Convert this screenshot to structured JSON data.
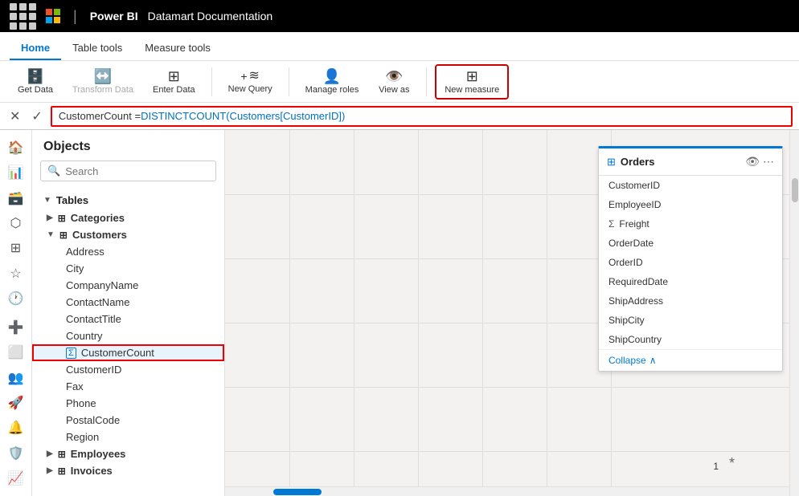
{
  "topbar": {
    "app_name": "Power BI",
    "doc_title": "Datamart Documentation"
  },
  "tabs": {
    "home": "Home",
    "table_tools": "Table tools",
    "measure_tools": "Measure tools"
  },
  "toolbar": {
    "get_data": "Get Data",
    "transform_data": "Transform Data",
    "enter_data": "Enter Data",
    "new_query": "New Query",
    "manage_roles": "Manage roles",
    "view_as": "View as",
    "new_measure": "New measure"
  },
  "formula": {
    "text": "CustomerCount = DISTINCTCOUNT(Customers[CustomerID])"
  },
  "objects_panel": {
    "title": "Objects",
    "search_placeholder": "Search"
  },
  "tree": {
    "tables_label": "Tables",
    "categories": "Categories",
    "customers": "Customers",
    "customers_fields": [
      "Address",
      "City",
      "CompanyName",
      "ContactName",
      "ContactTitle",
      "Country"
    ],
    "customer_count": "CustomerCount",
    "customers_fields2": [
      "CustomerID",
      "Fax",
      "Phone",
      "PostalCode",
      "Region"
    ],
    "employees": "Employees",
    "invoices": "Invoices"
  },
  "orders_card": {
    "title": "Orders",
    "fields": [
      "CustomerID",
      "EmployeeID",
      "Freight",
      "OrderDate",
      "OrderID",
      "RequiredDate",
      "ShipAddress",
      "ShipCity",
      "ShipCountry"
    ],
    "freight_has_sigma": true,
    "collapse_label": "Collapse"
  },
  "canvas": {
    "star1": "*",
    "star2": "*",
    "num1": "1"
  }
}
